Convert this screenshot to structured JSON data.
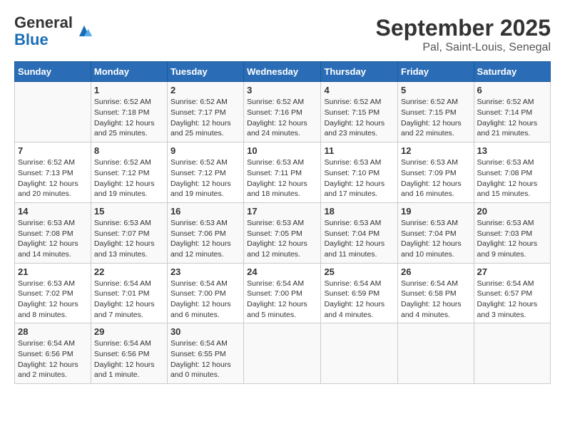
{
  "header": {
    "logo_line1": "General",
    "logo_line2": "Blue",
    "title": "September 2025",
    "subtitle": "Pal, Saint-Louis, Senegal"
  },
  "days_of_week": [
    "Sunday",
    "Monday",
    "Tuesday",
    "Wednesday",
    "Thursday",
    "Friday",
    "Saturday"
  ],
  "weeks": [
    [
      {
        "day": "",
        "info": ""
      },
      {
        "day": "1",
        "info": "Sunrise: 6:52 AM\nSunset: 7:18 PM\nDaylight: 12 hours\nand 25 minutes."
      },
      {
        "day": "2",
        "info": "Sunrise: 6:52 AM\nSunset: 7:17 PM\nDaylight: 12 hours\nand 25 minutes."
      },
      {
        "day": "3",
        "info": "Sunrise: 6:52 AM\nSunset: 7:16 PM\nDaylight: 12 hours\nand 24 minutes."
      },
      {
        "day": "4",
        "info": "Sunrise: 6:52 AM\nSunset: 7:15 PM\nDaylight: 12 hours\nand 23 minutes."
      },
      {
        "day": "5",
        "info": "Sunrise: 6:52 AM\nSunset: 7:15 PM\nDaylight: 12 hours\nand 22 minutes."
      },
      {
        "day": "6",
        "info": "Sunrise: 6:52 AM\nSunset: 7:14 PM\nDaylight: 12 hours\nand 21 minutes."
      }
    ],
    [
      {
        "day": "7",
        "info": "Sunrise: 6:52 AM\nSunset: 7:13 PM\nDaylight: 12 hours\nand 20 minutes."
      },
      {
        "day": "8",
        "info": "Sunrise: 6:52 AM\nSunset: 7:12 PM\nDaylight: 12 hours\nand 19 minutes."
      },
      {
        "day": "9",
        "info": "Sunrise: 6:52 AM\nSunset: 7:12 PM\nDaylight: 12 hours\nand 19 minutes."
      },
      {
        "day": "10",
        "info": "Sunrise: 6:53 AM\nSunset: 7:11 PM\nDaylight: 12 hours\nand 18 minutes."
      },
      {
        "day": "11",
        "info": "Sunrise: 6:53 AM\nSunset: 7:10 PM\nDaylight: 12 hours\nand 17 minutes."
      },
      {
        "day": "12",
        "info": "Sunrise: 6:53 AM\nSunset: 7:09 PM\nDaylight: 12 hours\nand 16 minutes."
      },
      {
        "day": "13",
        "info": "Sunrise: 6:53 AM\nSunset: 7:08 PM\nDaylight: 12 hours\nand 15 minutes."
      }
    ],
    [
      {
        "day": "14",
        "info": "Sunrise: 6:53 AM\nSunset: 7:08 PM\nDaylight: 12 hours\nand 14 minutes."
      },
      {
        "day": "15",
        "info": "Sunrise: 6:53 AM\nSunset: 7:07 PM\nDaylight: 12 hours\nand 13 minutes."
      },
      {
        "day": "16",
        "info": "Sunrise: 6:53 AM\nSunset: 7:06 PM\nDaylight: 12 hours\nand 12 minutes."
      },
      {
        "day": "17",
        "info": "Sunrise: 6:53 AM\nSunset: 7:05 PM\nDaylight: 12 hours\nand 12 minutes."
      },
      {
        "day": "18",
        "info": "Sunrise: 6:53 AM\nSunset: 7:04 PM\nDaylight: 12 hours\nand 11 minutes."
      },
      {
        "day": "19",
        "info": "Sunrise: 6:53 AM\nSunset: 7:04 PM\nDaylight: 12 hours\nand 10 minutes."
      },
      {
        "day": "20",
        "info": "Sunrise: 6:53 AM\nSunset: 7:03 PM\nDaylight: 12 hours\nand 9 minutes."
      }
    ],
    [
      {
        "day": "21",
        "info": "Sunrise: 6:53 AM\nSunset: 7:02 PM\nDaylight: 12 hours\nand 8 minutes."
      },
      {
        "day": "22",
        "info": "Sunrise: 6:54 AM\nSunset: 7:01 PM\nDaylight: 12 hours\nand 7 minutes."
      },
      {
        "day": "23",
        "info": "Sunrise: 6:54 AM\nSunset: 7:00 PM\nDaylight: 12 hours\nand 6 minutes."
      },
      {
        "day": "24",
        "info": "Sunrise: 6:54 AM\nSunset: 7:00 PM\nDaylight: 12 hours\nand 5 minutes."
      },
      {
        "day": "25",
        "info": "Sunrise: 6:54 AM\nSunset: 6:59 PM\nDaylight: 12 hours\nand 4 minutes."
      },
      {
        "day": "26",
        "info": "Sunrise: 6:54 AM\nSunset: 6:58 PM\nDaylight: 12 hours\nand 4 minutes."
      },
      {
        "day": "27",
        "info": "Sunrise: 6:54 AM\nSunset: 6:57 PM\nDaylight: 12 hours\nand 3 minutes."
      }
    ],
    [
      {
        "day": "28",
        "info": "Sunrise: 6:54 AM\nSunset: 6:56 PM\nDaylight: 12 hours\nand 2 minutes."
      },
      {
        "day": "29",
        "info": "Sunrise: 6:54 AM\nSunset: 6:56 PM\nDaylight: 12 hours\nand 1 minute."
      },
      {
        "day": "30",
        "info": "Sunrise: 6:54 AM\nSunset: 6:55 PM\nDaylight: 12 hours\nand 0 minutes."
      },
      {
        "day": "",
        "info": ""
      },
      {
        "day": "",
        "info": ""
      },
      {
        "day": "",
        "info": ""
      },
      {
        "day": "",
        "info": ""
      }
    ]
  ]
}
